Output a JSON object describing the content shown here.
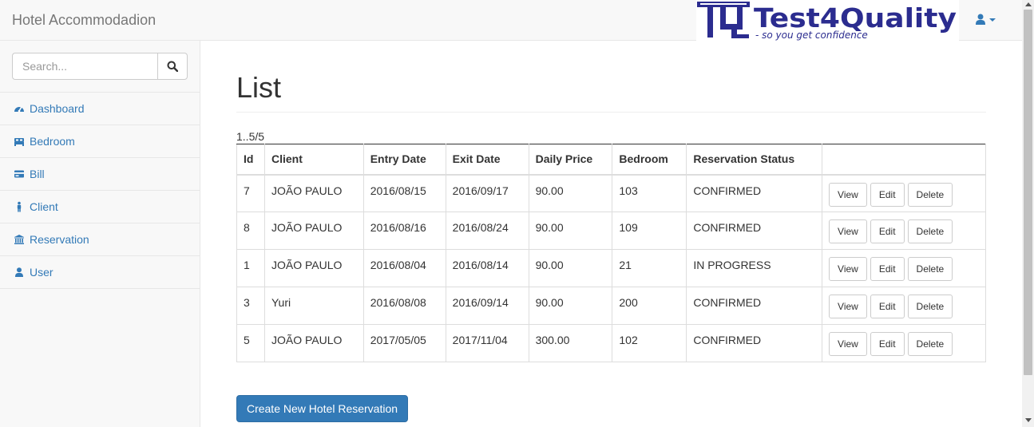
{
  "app": {
    "title": "Hotel Accommodadion"
  },
  "logo": {
    "name": "Test4Quality",
    "tagline": "- so you get confidence"
  },
  "colors": {
    "accent": "#337ab7",
    "logo_blue": "#2b2c8f"
  },
  "search": {
    "placeholder": "Search..."
  },
  "sidebar": {
    "items": [
      {
        "label": "Dashboard",
        "icon": "dashboard-icon"
      },
      {
        "label": "Bedroom",
        "icon": "bed-icon"
      },
      {
        "label": "Bill",
        "icon": "credit-card-icon"
      },
      {
        "label": "Client",
        "icon": "person-icon"
      },
      {
        "label": "Reservation",
        "icon": "bank-icon"
      },
      {
        "label": "User",
        "icon": "user-icon"
      }
    ]
  },
  "main": {
    "title": "List",
    "pagination": "1..5/5",
    "columns": [
      "Id",
      "Client",
      "Entry Date",
      "Exit Date",
      "Daily Price",
      "Bedroom",
      "Reservation Status"
    ],
    "actions": {
      "view": "View",
      "edit": "Edit",
      "delete": "Delete"
    },
    "rows": [
      [
        "7",
        "JOÃO PAULO",
        "2016/08/15",
        "2016/09/17",
        "90.00",
        "103",
        "CONFIRMED"
      ],
      [
        "8",
        "JOÃO PAULO",
        "2016/08/16",
        "2016/08/24",
        "90.00",
        "109",
        "CONFIRMED"
      ],
      [
        "1",
        "JOÃO PAULO",
        "2016/08/04",
        "2016/08/14",
        "90.00",
        "21",
        "IN PROGRESS"
      ],
      [
        "3",
        "Yuri",
        "2016/08/08",
        "2016/09/14",
        "90.00",
        "200",
        "CONFIRMED"
      ],
      [
        "5",
        "JOÃO PAULO",
        "2017/05/05",
        "2017/11/04",
        "300.00",
        "102",
        "CONFIRMED"
      ]
    ],
    "create_button": "Create New Hotel Reservation"
  }
}
